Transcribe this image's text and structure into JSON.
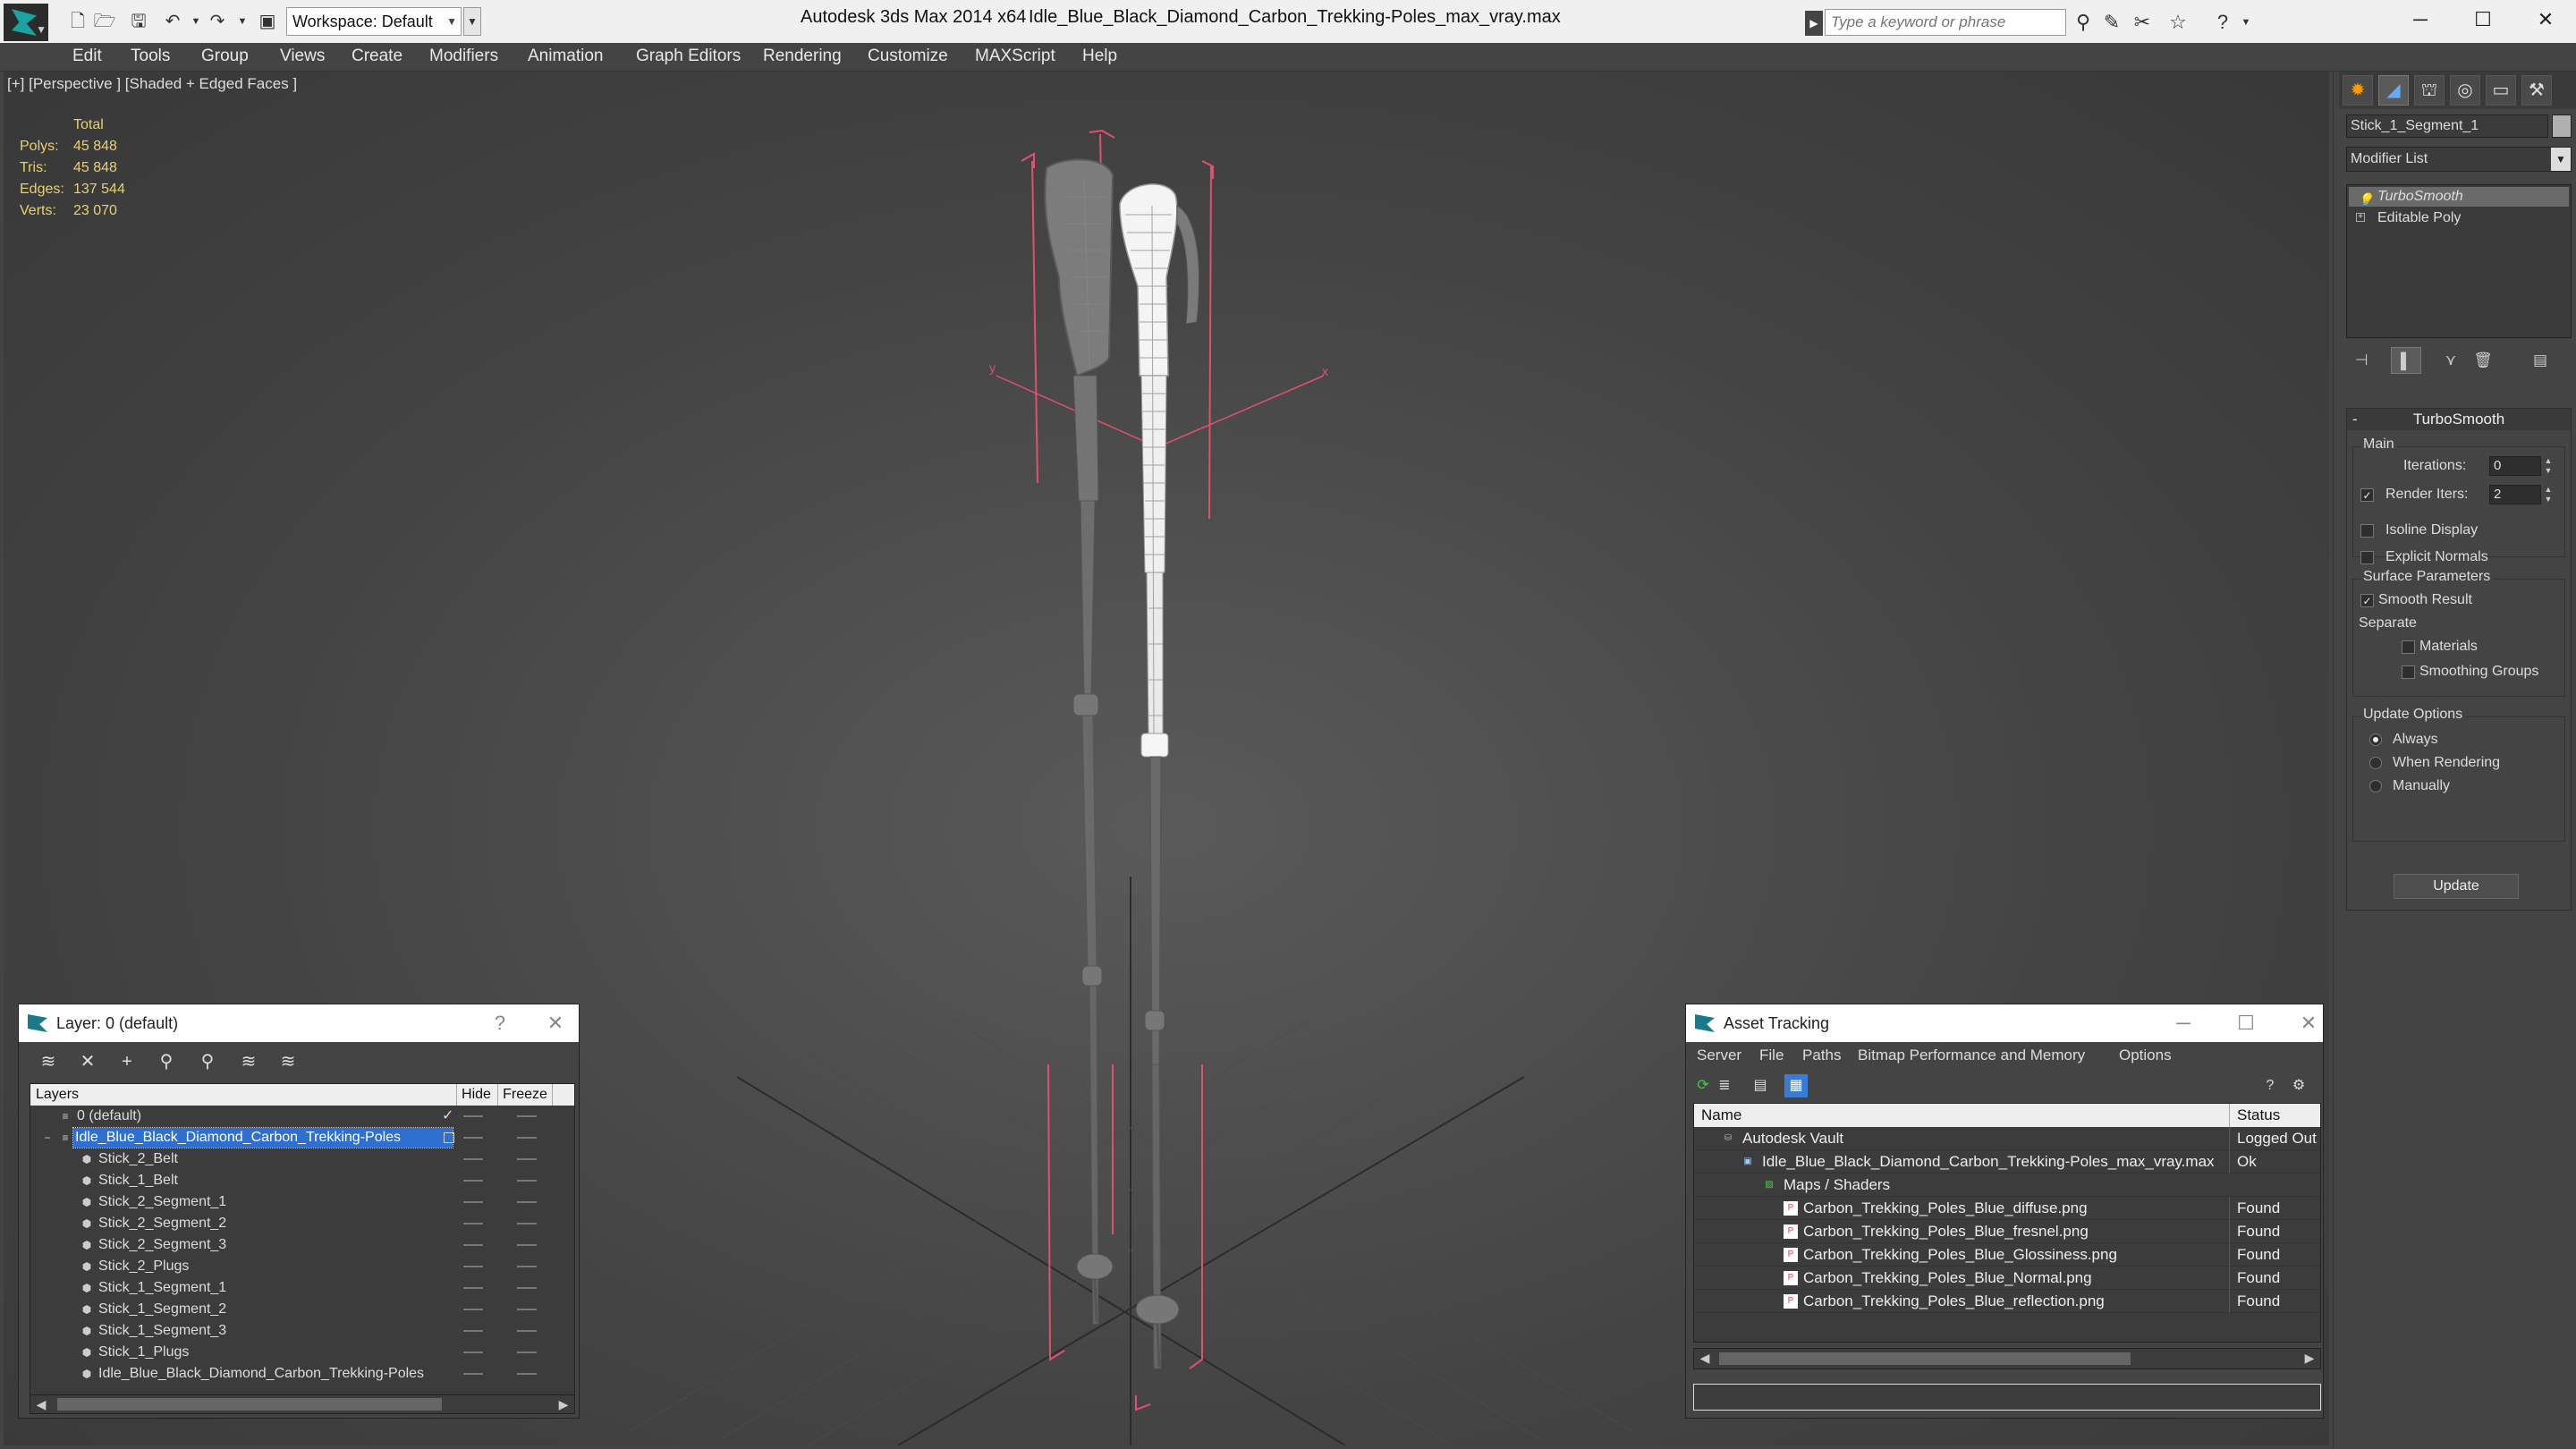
{
  "titlebar": {
    "workspace_label": "Workspace: Default",
    "app_title": "Autodesk 3ds Max  2014 x64",
    "file_title": "Idle_Blue_Black_Diamond_Carbon_Trekking-Poles_max_vray.max",
    "search_placeholder": "Type a keyword or phrase"
  },
  "menu": [
    "Edit",
    "Tools",
    "Group",
    "Views",
    "Create",
    "Modifiers",
    "Animation",
    "Graph Editors",
    "Rendering",
    "Customize",
    "MAXScript",
    "Help"
  ],
  "viewport": {
    "label": "[+] [Perspective ] [Shaded + Edged Faces ]",
    "stats": {
      "header": "Total",
      "polys_label": "Polys:",
      "polys": "45 848",
      "tris_label": "Tris:",
      "tris": "45 848",
      "edges_label": "Edges:",
      "edges": "137 544",
      "verts_label": "Verts:",
      "verts": "23 070"
    },
    "axis_x": "x",
    "axis_y": "y"
  },
  "command_panel": {
    "object_name": "Stick_1_Segment_1",
    "modifier_list_label": "Modifier List",
    "stack": [
      "TurboSmooth",
      "Editable Poly"
    ],
    "rollout_title": "TurboSmooth",
    "main_group": "Main",
    "iterations_label": "Iterations:",
    "iterations": "0",
    "render_iters_label": "Render Iters:",
    "render_iters": "2",
    "isoline_label": "Isoline Display",
    "explicit_normals_label": "Explicit Normals",
    "surface_group": "Surface Parameters",
    "smooth_result_label": "Smooth Result",
    "separate_label": "Separate",
    "materials_label": "Materials",
    "smoothing_groups_label": "Smoothing Groups",
    "update_group": "Update Options",
    "always_label": "Always",
    "when_rendering_label": "When Rendering",
    "manually_label": "Manually",
    "update_button": "Update"
  },
  "layer_window": {
    "title": "Layer: 0 (default)",
    "help": "?",
    "col_layers": "Layers",
    "col_hide": "Hide",
    "col_freeze": "Freeze",
    "rows": [
      "0 (default)",
      "Idle_Blue_Black_Diamond_Carbon_Trekking-Poles",
      "Stick_2_Belt",
      "Stick_1_Belt",
      "Stick_2_Segment_1",
      "Stick_2_Segment_2",
      "Stick_2_Segment_3",
      "Stick_2_Plugs",
      "Stick_1_Segment_1",
      "Stick_1_Segment_2",
      "Stick_1_Segment_3",
      "Stick_1_Plugs",
      "Idle_Blue_Black_Diamond_Carbon_Trekking-Poles"
    ]
  },
  "asset_window": {
    "title": "Asset Tracking",
    "menu": [
      "Server",
      "File",
      "Paths",
      "Bitmap Performance and Memory",
      "Options"
    ],
    "col_name": "Name",
    "col_status": "Status",
    "rows": [
      {
        "name": "Autodesk Vault",
        "status": "Logged Out"
      },
      {
        "name": "Idle_Blue_Black_Diamond_Carbon_Trekking-Poles_max_vray.max",
        "status": "Ok"
      },
      {
        "name": "Maps / Shaders",
        "status": ""
      },
      {
        "name": "Carbon_Trekking_Poles_Blue_diffuse.png",
        "status": "Found"
      },
      {
        "name": "Carbon_Trekking_Poles_Blue_fresnel.png",
        "status": "Found"
      },
      {
        "name": "Carbon_Trekking_Poles_Blue_Glossiness.png",
        "status": "Found"
      },
      {
        "name": "Carbon_Trekking_Poles_Blue_Normal.png",
        "status": "Found"
      },
      {
        "name": "Carbon_Trekking_Poles_Blue_reflection.png",
        "status": "Found"
      }
    ]
  },
  "colors": {
    "ui_bg": "#444444",
    "selection": "#2f6fd0",
    "stats_text": "#e8d070",
    "bbox_lines": "#e05070"
  }
}
